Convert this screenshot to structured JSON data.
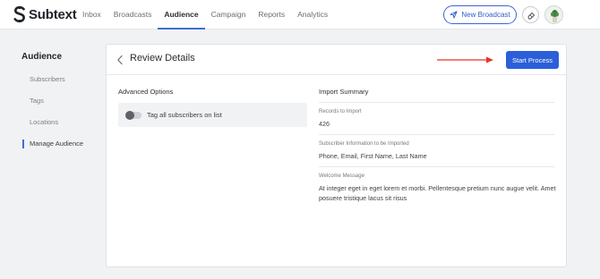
{
  "app": {
    "name": "Subtext"
  },
  "nav": {
    "items": [
      {
        "label": "Inbox"
      },
      {
        "label": "Broadcasts"
      },
      {
        "label": "Audience"
      },
      {
        "label": "Campaign"
      },
      {
        "label": "Reports"
      },
      {
        "label": "Analytics"
      }
    ],
    "active": "Audience",
    "new_broadcast_label": "New Broadcast"
  },
  "sidebar": {
    "title": "Audience",
    "items": [
      {
        "label": "Subscribers"
      },
      {
        "label": "Tags"
      },
      {
        "label": "Locations"
      },
      {
        "label": "Manage Audience"
      }
    ],
    "active": "Manage Audience"
  },
  "main": {
    "title": "Review Details",
    "start_button_label": "Start Process",
    "advanced_options": {
      "heading": "Advanced Options",
      "toggle_label": "Tag all subscribers on list",
      "toggle_on": false
    },
    "import_summary": {
      "heading": "Import Summary",
      "records_label": "Records to Import",
      "records_value": "426",
      "fields_label": "Subscriber Information to be Imported",
      "fields_value": "Phone, Email, First Name, Last Name",
      "welcome_label": "Welcome Message",
      "welcome_value": "At integer eget in eget lorem et morbi. Pellentesque pretium nunc augue velit. Amet posuere tristique lacus sit risus"
    }
  },
  "colors": {
    "accent": "#2b5fd9",
    "annotation_arrow": "#e8352a"
  },
  "icons": [
    "subtext-logo-icon",
    "send-icon",
    "eraser-icon",
    "plant-avatar-icon",
    "chevron-left-icon",
    "arrow-right-icon"
  ]
}
